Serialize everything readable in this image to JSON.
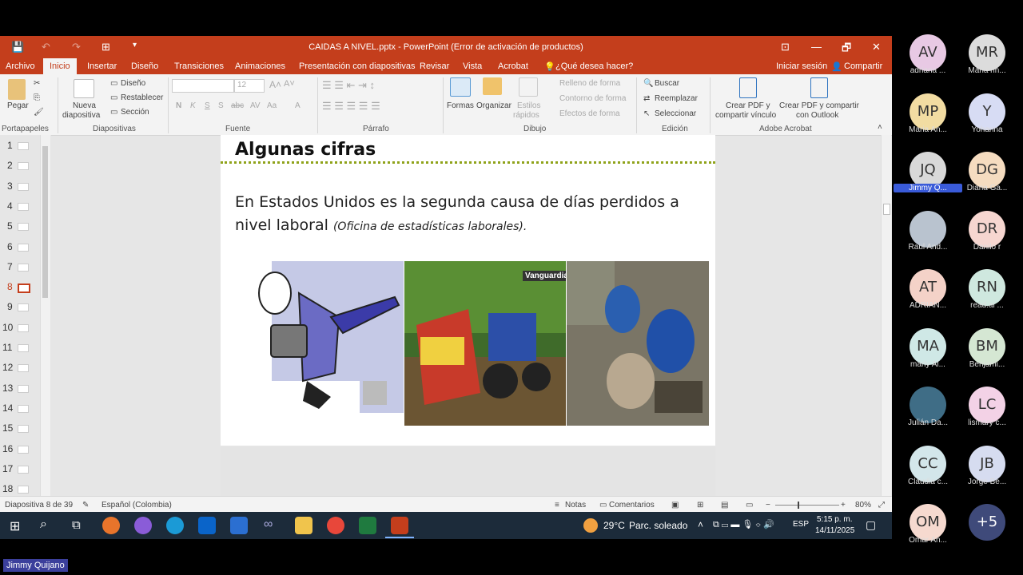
{
  "window": {
    "title": "CAIDAS A NIVEL.pptx - PowerPoint (Error de activación de productos)",
    "restore_label": "🗗",
    "minimize_label": "—",
    "close_label": "✕",
    "ribbon_display_label": "⊡"
  },
  "menu": {
    "items": [
      "Archivo",
      "Inicio",
      "Insertar",
      "Diseño",
      "Transiciones",
      "Animaciones",
      "Presentación con diapositivas",
      "Revisar",
      "Vista",
      "Acrobat"
    ],
    "tell_me": "¿Qué desea hacer?",
    "signin": "Iniciar sesión",
    "share": "Compartir"
  },
  "ribbon": {
    "paste": "Pegar",
    "new_slide_1": "Nueva",
    "new_slide_2": "diapositiva",
    "layout": "Diseño",
    "reset": "Restablecer",
    "section": "Sección",
    "font_size": "12",
    "shapes": "Formas",
    "arrange": "Organizar",
    "quick_styles_1": "Estilos",
    "quick_styles_2": "rápidos",
    "shape_fill": "Relleno de forma",
    "shape_outline": "Contorno de forma",
    "shape_effects": "Efectos de forma",
    "find": "Buscar",
    "replace": "Reemplazar",
    "select": "Seleccionar",
    "pdf_link_1": "Crear PDF y",
    "pdf_link_2": "compartir vínculo",
    "pdf_outlook_1": "Crear PDF y compartir",
    "pdf_outlook_2": "con Outlook",
    "groups": {
      "clipboard": "Portapapeles",
      "slides": "Diapositivas",
      "font": "Fuente",
      "paragraph": "Párrafo",
      "drawing": "Dibujo",
      "editing": "Edición",
      "acrobat": "Adobe Acrobat"
    },
    "font_buttons": [
      "N",
      "K",
      "S",
      "S",
      "abc",
      "AV",
      "Aa",
      "A"
    ]
  },
  "thumbnails": [
    "1",
    "2",
    "3",
    "4",
    "5",
    "6",
    "7",
    "8",
    "9",
    "10",
    "11",
    "12",
    "13",
    "14",
    "15",
    "16",
    "17",
    "18"
  ],
  "active_slide_index": 7,
  "slide": {
    "title": "Algunas cifras",
    "text": "En Estados Unidos es la segunda causa de días perdidos a nivel laboral",
    "source": "(Oficina de estadísticas laborales).",
    "logo_text": "Vanguardia"
  },
  "status": {
    "slide_info": "Diapositiva 8 de 39",
    "language": "Español (Colombia)",
    "notes": "Notas",
    "comments": "Comentarios",
    "zoom": "80%"
  },
  "taskbar": {
    "temperature": "29°C",
    "weather": "Parc. soleado",
    "lang": "ESP",
    "time": "5:15 p. m.",
    "date": "14/11/2025"
  },
  "participants": [
    {
      "initials": "AV",
      "name": "adriana ...",
      "color": "#e8c9e4"
    },
    {
      "initials": "MR",
      "name": "Maria rin...",
      "color": "#dcdcdc"
    },
    {
      "initials": "MP",
      "name": "Maria An...",
      "color": "#f2dca2"
    },
    {
      "initials": "Y",
      "name": "Yohanna",
      "color": "#d7dcf4"
    },
    {
      "initials": "JQ",
      "name": "Jimmy Q...",
      "color": "#d9d9d9"
    },
    {
      "initials": "DG",
      "name": "Diana Ga...",
      "color": "#f5dcc0"
    },
    {
      "initials": "",
      "name": "Raul And...",
      "color": "#b9c3cf"
    },
    {
      "initials": "DR",
      "name": "Danilo r",
      "color": "#f6d6d0"
    },
    {
      "initials": "AT",
      "name": "ADRIAN...",
      "color": "#f4d2c8"
    },
    {
      "initials": "RN",
      "name": "read.ai ...",
      "color": "#cfe8df"
    },
    {
      "initials": "MA",
      "name": "marly Al...",
      "color": "#cfe8e6"
    },
    {
      "initials": "BM",
      "name": "Benjami...",
      "color": "#d5e7d3"
    },
    {
      "initials": "",
      "name": "Julián Da...",
      "color": "#3f6d86"
    },
    {
      "initials": "LC",
      "name": "lismary c...",
      "color": "#f3d2e6"
    },
    {
      "initials": "CC",
      "name": "Claudia c...",
      "color": "#d3e6ea"
    },
    {
      "initials": "JB",
      "name": "Jorge Be...",
      "color": "#d6dcf0"
    },
    {
      "initials": "OM",
      "name": "Omar An...",
      "color": "#f6d9cf"
    },
    {
      "initials": "+5",
      "name": "",
      "color": "#3f4a7a"
    }
  ],
  "speaker_name": "Jimmy Quijano",
  "colors": {
    "accent": "#c43e1c",
    "divider": "#8fa31a"
  }
}
